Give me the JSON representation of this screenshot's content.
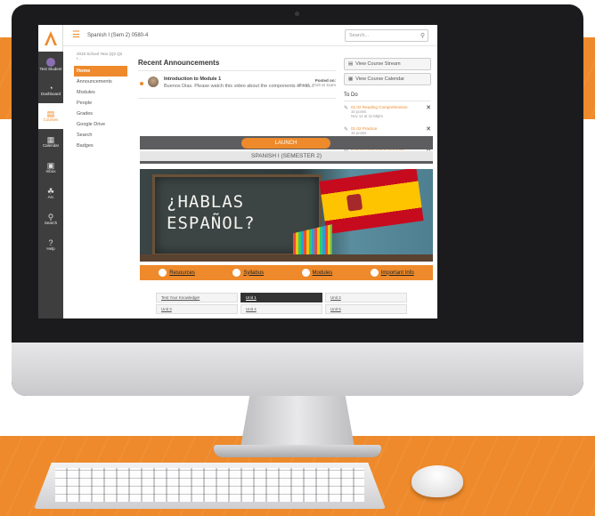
{
  "colors": {
    "accent": "#ee8a2b",
    "nav_dark": "#3e3e3e",
    "bezel": "#1b1b1d"
  },
  "global_nav": {
    "items": [
      {
        "label": "Test Student",
        "icon": "user-avatar-icon"
      },
      {
        "label": "Dashboard",
        "icon": "dashboard-icon"
      },
      {
        "label": "Courses",
        "icon": "courses-icon",
        "active": true
      },
      {
        "label": "Calendar",
        "icon": "calendar-icon"
      },
      {
        "label": "Inbox",
        "icon": "inbox-icon"
      },
      {
        "label": "Arc",
        "icon": "arc-icon"
      },
      {
        "label": "Search",
        "icon": "search-icon"
      },
      {
        "label": "Help",
        "icon": "help-icon"
      }
    ]
  },
  "topbar": {
    "breadcrumb": "Spanish I (Sem 2) 0580-4",
    "search_placeholder": "Search..."
  },
  "course_nav": {
    "term": "2019 School Year (Q2 Q2 I...",
    "items": [
      "Home",
      "Announcements",
      "Modules",
      "People",
      "Grades",
      "Google Drive",
      "Search",
      "Badges"
    ]
  },
  "announcements": {
    "title": "Recent Announcements",
    "items": [
      {
        "heading": "Introduction to Module 1",
        "body": "Buenos Dias. Please watch this video about the components of mis...",
        "posted_label": "Posted on:",
        "posted_date": "Oct 17, 2019 at 11am"
      }
    ]
  },
  "sidebar": {
    "buttons": [
      "View Course Stream",
      "View Course Calendar"
    ],
    "todo_title": "To Do",
    "todos": [
      {
        "title": "01.02 Reading Comprehension",
        "points": "10 points",
        "due": "Nov 14 at 11:59pm"
      },
      {
        "title": "01.02 Practice",
        "points": "10 points",
        "due": "Nov 14 at 11:59pm"
      },
      {
        "title": "2 weeks until end of semester",
        "points": "",
        "due": "Nov 27 at 7:00pm"
      }
    ]
  },
  "course_page": {
    "launch": "LAUNCH",
    "course_title": "SPANISH I (SEMESTER 2)",
    "banner_line1": "¿HABLAS",
    "banner_line2": "ESPAÑOL?",
    "tabs": [
      "Resources",
      "Syllabus",
      "Modules",
      "Important Info"
    ],
    "units": [
      [
        "Test Your Knowledge!",
        "Unit 1",
        "Unit 2"
      ],
      [
        "Unit 3",
        "Unit 4",
        "Unit 5"
      ]
    ]
  }
}
